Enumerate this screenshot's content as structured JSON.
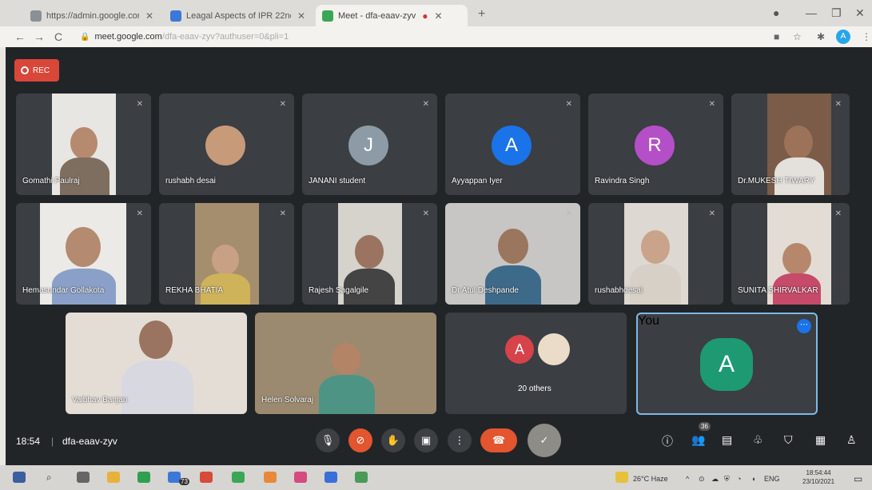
{
  "browser": {
    "tabs": [
      {
        "label": "https://admin.google.com/a/cp...",
        "color": "#4a7fd0"
      },
      {
        "label": "Leagal Aspects of IPR 22nd & 2...",
        "color": "#3c78d8"
      },
      {
        "label": "Meet - dfa-eaav-zyv",
        "color": "#3aa757"
      }
    ],
    "url_host": "meet.google.com",
    "url_path": "/dfa-eaav-zyv?authuser=0&pli=1",
    "profile_initial": "A"
  },
  "meet": {
    "rec_label": "REC",
    "participants": [
      {
        "name": "Gomathi Paulraj",
        "type": "video",
        "bg": "#e8e6e2",
        "skin": "#b58a6e",
        "shirt": "#7e6e60"
      },
      {
        "name": "rushabh desai",
        "type": "photo",
        "bg": "#3b3e42",
        "skin": "#c79a7a",
        "shirt": "#6b8f4a"
      },
      {
        "name": "JANANI student",
        "type": "avatar",
        "initial": "J",
        "color": "#8c9ba5"
      },
      {
        "name": "Ayyappan Iyer",
        "type": "avatar",
        "initial": "A",
        "color": "#1a73e8"
      },
      {
        "name": "Ravindra Singh",
        "type": "avatar",
        "initial": "R",
        "color": "#b44fc7"
      },
      {
        "name": "Dr.MUKESH TIWARY",
        "type": "video",
        "bg": "#7a5c48",
        "skin": "#9c7359",
        "shirt": "#e4e0dc"
      },
      {
        "name": "Hemasundar Gollakota",
        "type": "video",
        "bg": "#eceae6",
        "skin": "#b48a70",
        "shirt": "#8aa0c8"
      },
      {
        "name": "REKHA BHATIA",
        "type": "video",
        "bg": "#a58e6e",
        "skin": "#c8a084",
        "shirt": "#cfb35a"
      },
      {
        "name": "Rajesh Sagalgile",
        "type": "video",
        "bg": "#d6d2cc",
        "skin": "#9a7460",
        "shirt": "#444"
      },
      {
        "name": "Dr Atul Deshpande",
        "type": "video",
        "bg": "#c8c6c4",
        "skin": "#9a765e",
        "shirt": "#3e6a8a"
      },
      {
        "name": "rushabhdesai",
        "type": "video",
        "bg": "#ddd8d2",
        "skin": "#c9a48a",
        "shirt": "#d6d0c6"
      },
      {
        "name": "SUNITA SHIRVALKAR",
        "type": "video",
        "bg": "#e2dcd4",
        "skin": "#b6876a",
        "shirt": "#c64a6a"
      },
      {
        "name": "Vaibhav Banjan",
        "type": "video",
        "bg": "#e4ddd6",
        "skin": "#9a7460",
        "shirt": "#d8d8e0"
      },
      {
        "name": "Helen Solvaraj",
        "type": "video",
        "bg": "#9b8a70",
        "skin": "#b48466",
        "shirt": "#4e9484"
      }
    ],
    "others": {
      "initial": "A",
      "color": "#d6434a",
      "label": "20 others"
    },
    "you": {
      "initial": "A",
      "color": "#1e9a72",
      "label": "You"
    },
    "time": "18:54",
    "meeting_code": "dfa-eaav-zyv",
    "people_count": "36"
  },
  "taskbar": {
    "weather": "26°C Haze",
    "lang": "ENG",
    "time": "18:54:44",
    "date": "23/10/2021",
    "notif_badge": "73"
  }
}
